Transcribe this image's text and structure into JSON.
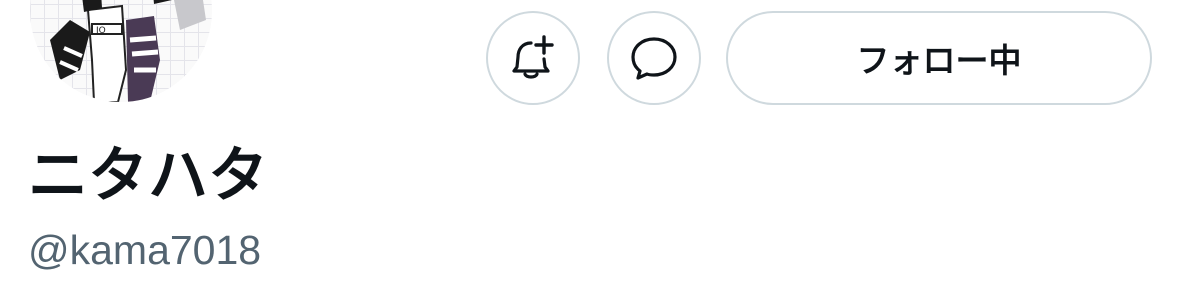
{
  "profile": {
    "avatar_icon": "user-avatar-image",
    "display_name": "ニタハタ",
    "handle": "@kama7018"
  },
  "actions": {
    "notify_icon": "bell-plus-icon",
    "message_icon": "message-bubble-icon",
    "follow_label": "フォロー中"
  },
  "colors": {
    "text_primary": "#0f1419",
    "text_secondary": "#536471",
    "button_border": "#cfd9de",
    "background": "#ffffff"
  }
}
